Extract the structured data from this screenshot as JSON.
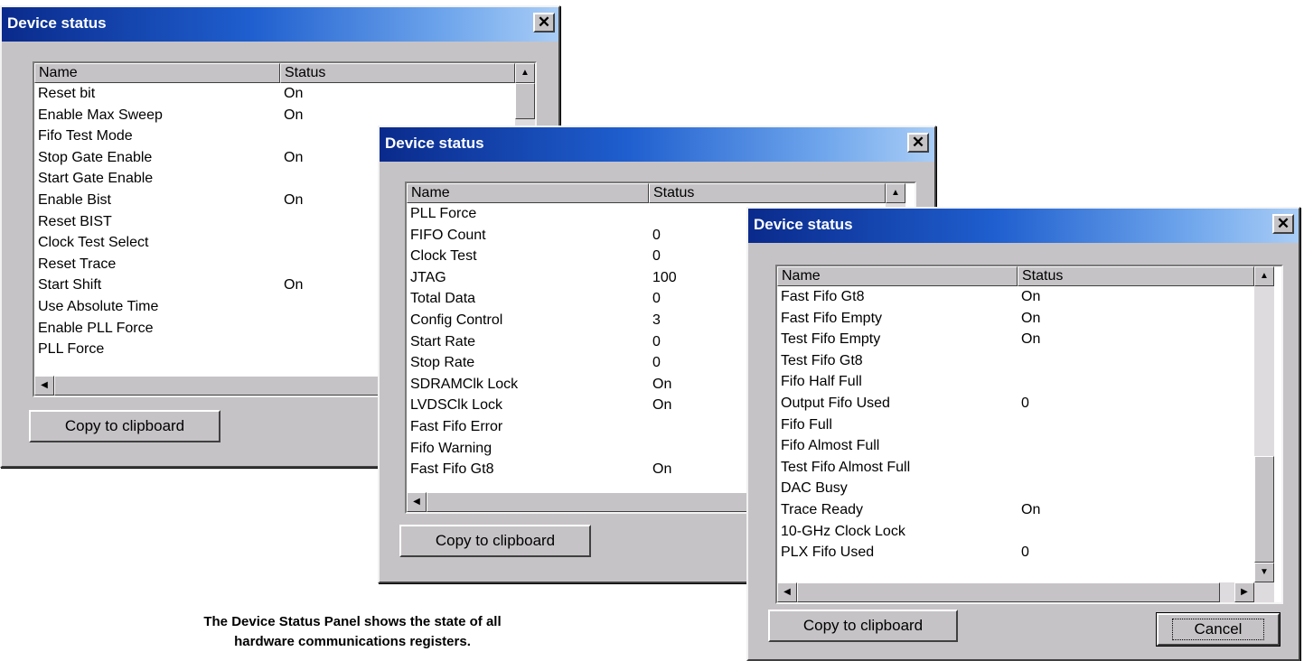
{
  "dialogs": [
    {
      "title": "Device status",
      "close": "✕",
      "headers": {
        "name": "Name",
        "status": "Status"
      },
      "rows": [
        {
          "name": "Reset bit",
          "status": "On"
        },
        {
          "name": "Enable Max Sweep",
          "status": "On"
        },
        {
          "name": "Fifo Test Mode",
          "status": ""
        },
        {
          "name": "Stop Gate Enable",
          "status": "On"
        },
        {
          "name": "Start Gate Enable",
          "status": ""
        },
        {
          "name": "Enable Bist",
          "status": "On"
        },
        {
          "name": "Reset BIST",
          "status": ""
        },
        {
          "name": "Clock Test Select",
          "status": ""
        },
        {
          "name": "Reset Trace",
          "status": ""
        },
        {
          "name": "Start Shift",
          "status": "On"
        },
        {
          "name": "Use Absolute Time",
          "status": ""
        },
        {
          "name": "Enable PLL Force",
          "status": ""
        },
        {
          "name": "PLL Force",
          "status": ""
        }
      ],
      "copy_label": "Copy to clipboard"
    },
    {
      "title": "Device status",
      "close": "✕",
      "headers": {
        "name": "Name",
        "status": "Status"
      },
      "rows": [
        {
          "name": "PLL Force",
          "status": ""
        },
        {
          "name": "FIFO Count",
          "status": "0"
        },
        {
          "name": "Clock Test",
          "status": "0"
        },
        {
          "name": "JTAG",
          "status": "100"
        },
        {
          "name": "Total Data",
          "status": "0"
        },
        {
          "name": "Config Control",
          "status": "3"
        },
        {
          "name": "Start Rate",
          "status": "0"
        },
        {
          "name": "Stop Rate",
          "status": "0"
        },
        {
          "name": "SDRAMClk Lock",
          "status": "On"
        },
        {
          "name": "LVDSClk Lock",
          "status": "On"
        },
        {
          "name": "Fast Fifo Error",
          "status": ""
        },
        {
          "name": "Fifo Warning",
          "status": ""
        },
        {
          "name": "Fast Fifo Gt8",
          "status": "On"
        }
      ],
      "copy_label": "Copy to clipboard"
    },
    {
      "title": "Device status",
      "close": "✕",
      "headers": {
        "name": "Name",
        "status": "Status"
      },
      "rows": [
        {
          "name": "Fast Fifo Gt8",
          "status": "On"
        },
        {
          "name": "Fast Fifo Empty",
          "status": "On"
        },
        {
          "name": "Test Fifo Empty",
          "status": "On"
        },
        {
          "name": "Test Fifo Gt8",
          "status": ""
        },
        {
          "name": "Fifo Half Full",
          "status": ""
        },
        {
          "name": "Output Fifo Used",
          "status": "0"
        },
        {
          "name": "Fifo Full",
          "status": ""
        },
        {
          "name": "Fifo Almost Full",
          "status": ""
        },
        {
          "name": "Test Fifo Almost Full",
          "status": ""
        },
        {
          "name": "DAC Busy",
          "status": ""
        },
        {
          "name": "Trace Ready",
          "status": "On"
        },
        {
          "name": "10-GHz Clock Lock",
          "status": ""
        },
        {
          "name": "PLX Fifo Used",
          "status": "0"
        }
      ],
      "copy_label": "Copy to clipboard",
      "cancel_label": "Cancel"
    }
  ],
  "caption": {
    "line1": "The Device Status Panel shows the state of all",
    "line2": "hardware communications registers."
  },
  "colors": {
    "title_bar_start": "#0a2a8c",
    "title_bar_end": "#a9cdf6",
    "dialog_face": "#c6c3c6"
  }
}
